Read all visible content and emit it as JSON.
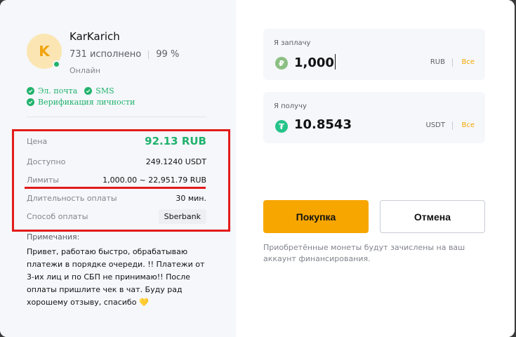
{
  "seller": {
    "avatar_letter": "K",
    "name": "KarKarich",
    "orders": "731 исполнено",
    "completion": "99 %",
    "status": "Онлайн",
    "badges": [
      "Эл. почта",
      "SMS",
      "Верификация личности"
    ]
  },
  "details": {
    "price_label": "Цена",
    "price_value": "92.13 RUB",
    "available_label": "Доступно",
    "available_value": "249.1240 USDT",
    "limits_label": "Лимиты",
    "limits_value": "1,000.00 ~ 22,951.79 RUB",
    "duration_label": "Длительность оплаты",
    "duration_value": "30 мин.",
    "payment_label": "Способ оплаты",
    "payment_value": "Sberbank"
  },
  "notes": {
    "title": "Примечания:",
    "text": "Привет, работаю быстро, обрабатываю платежи в порядке очереди. !! Платежи от 3-их лиц и по СБП не принимаю!! После оплаты пришлите чек в чат. Буду рад хорошему отзыву, спасибо",
    "emoji": "💛"
  },
  "pay": {
    "label": "Я заплачу",
    "amount": "1,000",
    "currency": "RUB",
    "all": "Все",
    "coin_symbol": "₽"
  },
  "receive": {
    "label": "Я получу",
    "amount": "10.8543",
    "currency": "USDT",
    "all": "Все",
    "coin_symbol": "₮"
  },
  "buttons": {
    "buy": "Покупка",
    "cancel": "Отмена"
  },
  "footnote": "Приобретённые монеты будут зачислены на ваш аккаунт финансирования.",
  "colors": {
    "accent": "#f7a600",
    "success": "#20b26c",
    "highlight": "#e31b1b"
  }
}
